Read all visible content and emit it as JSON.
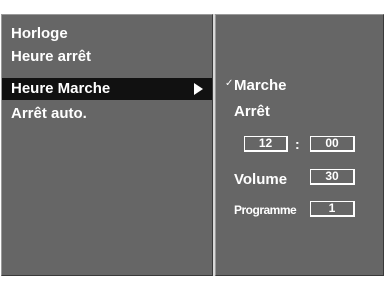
{
  "menu": {
    "items": [
      {
        "label": "Horloge",
        "selected": false
      },
      {
        "label": "Heure arrêt",
        "selected": false
      },
      {
        "label": "Heure Marche",
        "selected": true
      },
      {
        "label": "Arrêt auto.",
        "selected": false
      }
    ]
  },
  "submenu": {
    "options": [
      {
        "label": "Marche",
        "checked": true
      },
      {
        "label": "Arrêt",
        "checked": false
      }
    ],
    "time": {
      "hour": "12",
      "separator": ":",
      "minute": "00"
    },
    "volume": {
      "label": "Volume",
      "value": "30"
    },
    "programme": {
      "label": "Programme",
      "value": "1"
    }
  },
  "icons": {
    "submenu_arrow": "right-triangle-icon",
    "check": "check-mark-icon"
  },
  "colors": {
    "panel": "#666666",
    "highlight": "#111111",
    "text": "#ffffff",
    "background": "#ffffff"
  }
}
